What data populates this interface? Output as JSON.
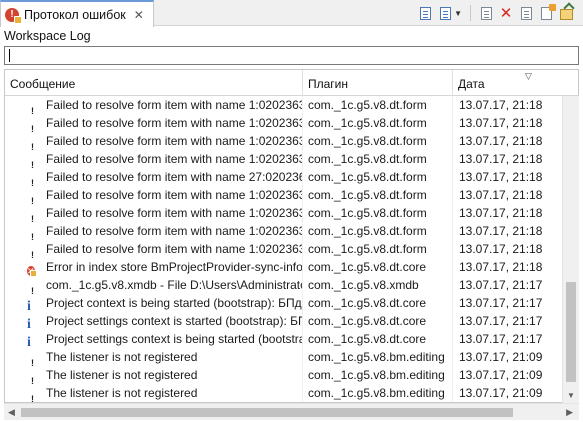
{
  "view": {
    "tab_title": "Протокол ошибок",
    "tab_close": "✕",
    "subtitle": "Workspace Log",
    "filter_value": ""
  },
  "toolbar": {
    "buttons": [
      "export-log-icon",
      "filter-icon",
      "view-menu-icon",
      "clear-log-icon",
      "delete-log-icon",
      "open-log-icon",
      "restore-log-icon"
    ]
  },
  "table": {
    "columns": {
      "message": "Сообщение",
      "plugin": "Плагин",
      "date": "Дата"
    },
    "rows": [
      {
        "type": "warning",
        "message": "Failed to resolve form item with name 1:02023637",
        "plugin": "com._1c.g5.v8.dt.form",
        "date": "13.07.17, 21:18"
      },
      {
        "type": "warning",
        "message": "Failed to resolve form item with name 1:02023637",
        "plugin": "com._1c.g5.v8.dt.form",
        "date": "13.07.17, 21:18"
      },
      {
        "type": "warning",
        "message": "Failed to resolve form item with name 1:02023637",
        "plugin": "com._1c.g5.v8.dt.form",
        "date": "13.07.17, 21:18"
      },
      {
        "type": "warning",
        "message": "Failed to resolve form item with name 1:02023637",
        "plugin": "com._1c.g5.v8.dt.form",
        "date": "13.07.17, 21:18"
      },
      {
        "type": "warning",
        "message": "Failed to resolve form item with name 27:02023637",
        "plugin": "com._1c.g5.v8.dt.form",
        "date": "13.07.17, 21:18"
      },
      {
        "type": "warning",
        "message": "Failed to resolve form item with name 1:02023637",
        "plugin": "com._1c.g5.v8.dt.form",
        "date": "13.07.17, 21:18"
      },
      {
        "type": "warning",
        "message": "Failed to resolve form item with name 1:02023637",
        "plugin": "com._1c.g5.v8.dt.form",
        "date": "13.07.17, 21:18"
      },
      {
        "type": "warning",
        "message": "Failed to resolve form item with name 1:02023637",
        "plugin": "com._1c.g5.v8.dt.form",
        "date": "13.07.17, 21:18"
      },
      {
        "type": "warning",
        "message": "Failed to resolve form item with name 1:02023637",
        "plugin": "com._1c.g5.v8.dt.form",
        "date": "13.07.17, 21:18"
      },
      {
        "type": "error",
        "message": "Error in index store BmProjectProvider-sync-info",
        "plugin": "com._1c.g5.v8.dt.core",
        "date": "13.07.17, 21:18"
      },
      {
        "type": "warning",
        "message": "com._1c.g5.v8.xmdb  - File D:\\Users\\Administrator",
        "plugin": "com._1c.g5.v8.xmdb",
        "date": "13.07.17, 21:17"
      },
      {
        "type": "info",
        "message": "Project context is being started (bootstrap): БПдемо",
        "plugin": "com._1c.g5.v8.dt.core",
        "date": "13.07.17, 21:17"
      },
      {
        "type": "info",
        "message": "Project settings context is started (bootstrap): БПдемо",
        "plugin": "com._1c.g5.v8.dt.core",
        "date": "13.07.17, 21:17"
      },
      {
        "type": "info",
        "message": "Project settings context is being started (bootstrap)",
        "plugin": "com._1c.g5.v8.dt.core",
        "date": "13.07.17, 21:17"
      },
      {
        "type": "warning",
        "message": "The listener is not registered",
        "plugin": "com._1c.g5.v8.bm.editing",
        "date": "13.07.17, 21:09"
      },
      {
        "type": "warning",
        "message": "The listener is not registered",
        "plugin": "com._1c.g5.v8.bm.editing",
        "date": "13.07.17, 21:09"
      },
      {
        "type": "warning",
        "message": "The listener is not registered",
        "plugin": "com._1c.g5.v8.bm.editing",
        "date": "13.07.17, 21:09"
      }
    ]
  }
}
